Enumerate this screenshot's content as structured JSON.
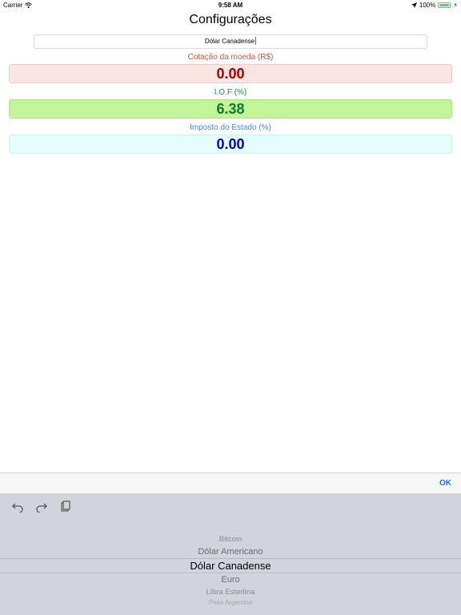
{
  "status_bar": {
    "carrier": "Carrier",
    "time": "9:58 AM",
    "battery": "100%",
    "battery_level": 1.0
  },
  "title": "Configurações",
  "currency_field": {
    "value": "Dólar Canadense"
  },
  "fields": {
    "cotacao": {
      "label": "Cotação da moeda (R$)",
      "value": "0.00"
    },
    "iof": {
      "label": "I.O.F (%)",
      "value": "6.38"
    },
    "estado": {
      "label": "Imposto do Estado (%)",
      "value": "0.00"
    }
  },
  "toolbar": {
    "ok_label": "OK"
  },
  "picker": {
    "options": [
      "Bitcoin",
      "Dólar Americano",
      "Dólar Canadense",
      "Euro",
      "Libra Esterlina",
      "Peso Argentino"
    ],
    "selected": "Dólar Canadense"
  },
  "colors": {
    "accent": "#1e6ff5",
    "cotacao_text": "#a80000",
    "iof_text": "#0c7a2f",
    "estado_text": "#0000c0"
  },
  "icons": [
    "wifi-icon",
    "location-arrow-icon",
    "battery-icon",
    "charging-bolt-icon",
    "undo-icon",
    "redo-icon",
    "paste-icon"
  ]
}
